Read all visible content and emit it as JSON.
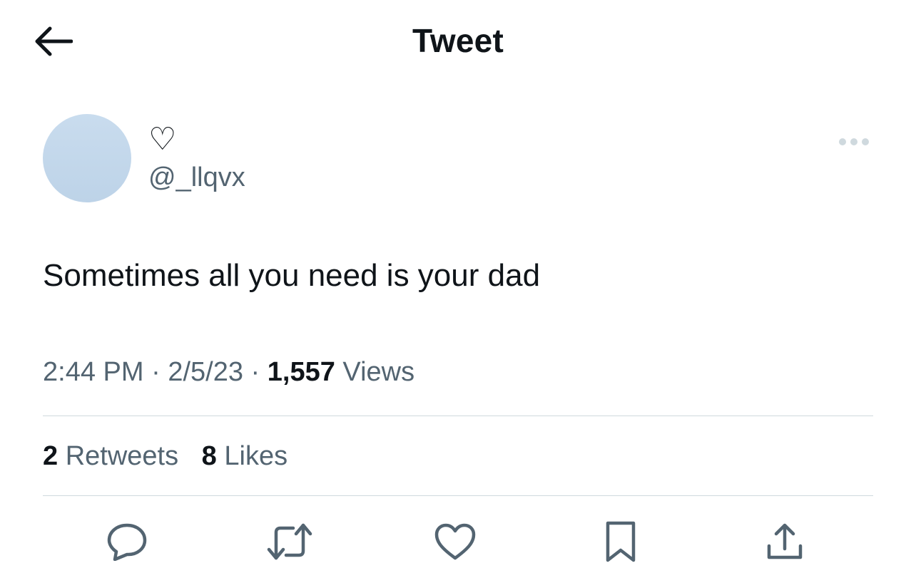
{
  "header": {
    "title": "Tweet",
    "back_icon": "arrow-left-icon"
  },
  "author": {
    "display_name": "♡",
    "handle": "@_llqvx",
    "avatar_color": "#c4d8ec"
  },
  "tweet": {
    "text": "Sometimes all you need is your dad"
  },
  "meta": {
    "time": "2:44 PM",
    "separator": "·",
    "date": "2/5/23",
    "views_count": "1,557",
    "views_label": "Views"
  },
  "stats": {
    "retweets_count": "2",
    "retweets_label": "Retweets",
    "likes_count": "8",
    "likes_label": "Likes"
  },
  "actions": [
    {
      "icon": "reply-icon"
    },
    {
      "icon": "retweet-icon"
    },
    {
      "icon": "heart-icon"
    },
    {
      "icon": "bookmark-icon"
    },
    {
      "icon": "share-icon"
    }
  ],
  "colors": {
    "text_primary": "#0f1419",
    "text_secondary": "#536471",
    "divider": "#cfd9de",
    "icon": "#536471"
  }
}
